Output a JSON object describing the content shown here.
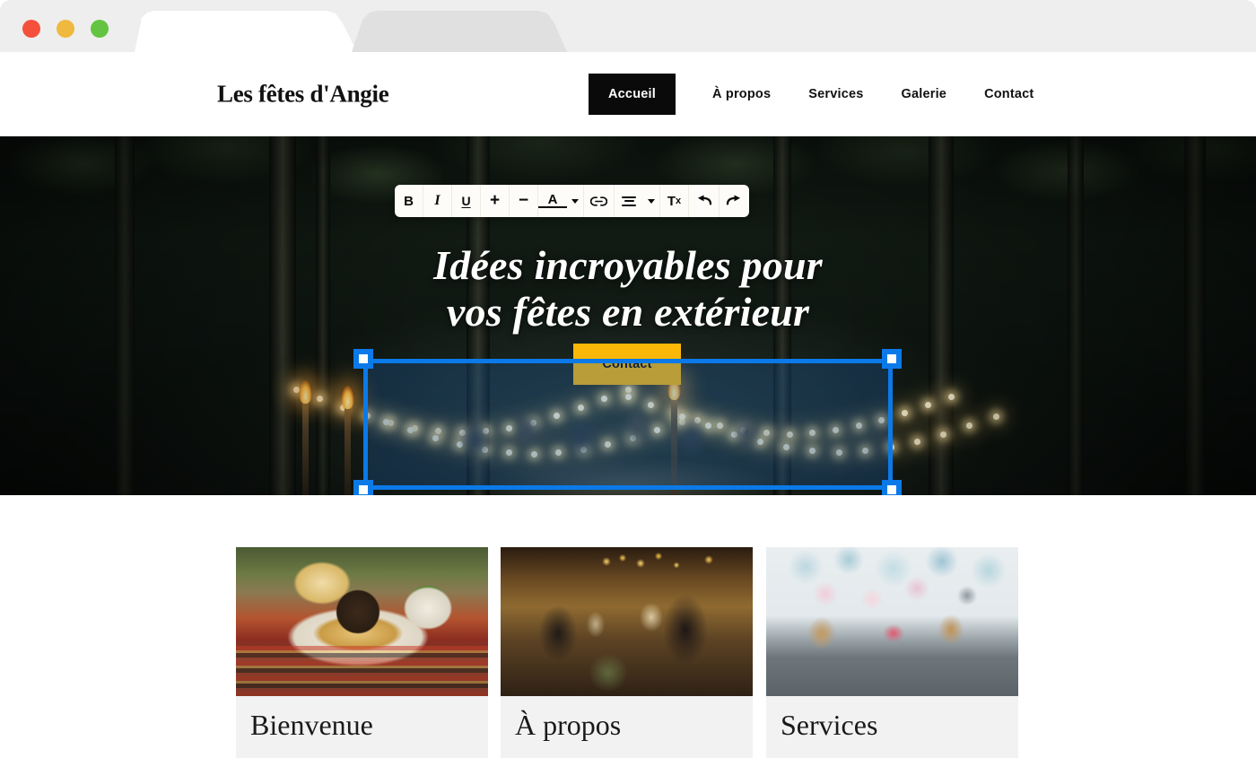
{
  "browser": {
    "traffic_lights": [
      {
        "name": "close",
        "color": "#f4503c"
      },
      {
        "name": "minimize",
        "color": "#efb93f"
      },
      {
        "name": "maximize",
        "color": "#62c440"
      }
    ],
    "tabs": [
      {
        "label": "",
        "active": true
      },
      {
        "label": "",
        "active": false
      }
    ]
  },
  "site": {
    "logo": "Les fêtes d'Angie",
    "nav": [
      {
        "label": "Accueil",
        "active": true
      },
      {
        "label": "À propos",
        "active": false
      },
      {
        "label": "Services",
        "active": false
      },
      {
        "label": "Galerie",
        "active": false
      },
      {
        "label": "Contact",
        "active": false
      }
    ]
  },
  "hero": {
    "title_line1": "Idées incroyables pour",
    "title_line2": "vos fêtes en extérieur",
    "cta_label": "Contact",
    "cta_color": "#fbb809",
    "selection_color": "#0b7ae8"
  },
  "toolbar": {
    "buttons": [
      {
        "name": "bold-button",
        "label": "B"
      },
      {
        "name": "italic-button",
        "label": "I"
      },
      {
        "name": "underline-button",
        "label": "U"
      },
      {
        "name": "increase-font-size-button",
        "label": "+"
      },
      {
        "name": "decrease-font-size-button",
        "label": "−"
      },
      {
        "name": "text-color-button",
        "label": "A"
      },
      {
        "name": "text-color-dropdown",
        "label": ""
      },
      {
        "name": "link-button",
        "label": "link-icon"
      },
      {
        "name": "align-button",
        "label": "align-icon"
      },
      {
        "name": "align-dropdown",
        "label": ""
      },
      {
        "name": "clear-formatting-button",
        "label": "Tx"
      },
      {
        "name": "undo-button",
        "label": "undo-icon"
      },
      {
        "name": "redo-button",
        "label": "redo-icon"
      }
    ],
    "tx_main": "T",
    "tx_sub": "x",
    "undo_glyph": "↰",
    "redo_glyph": "↱"
  },
  "cards": [
    {
      "title": "Bienvenue",
      "image": "food-platter-photo"
    },
    {
      "title": "À propos",
      "image": "people-toasting-photo"
    },
    {
      "title": "Services",
      "image": "dessert-table-photo"
    }
  ]
}
